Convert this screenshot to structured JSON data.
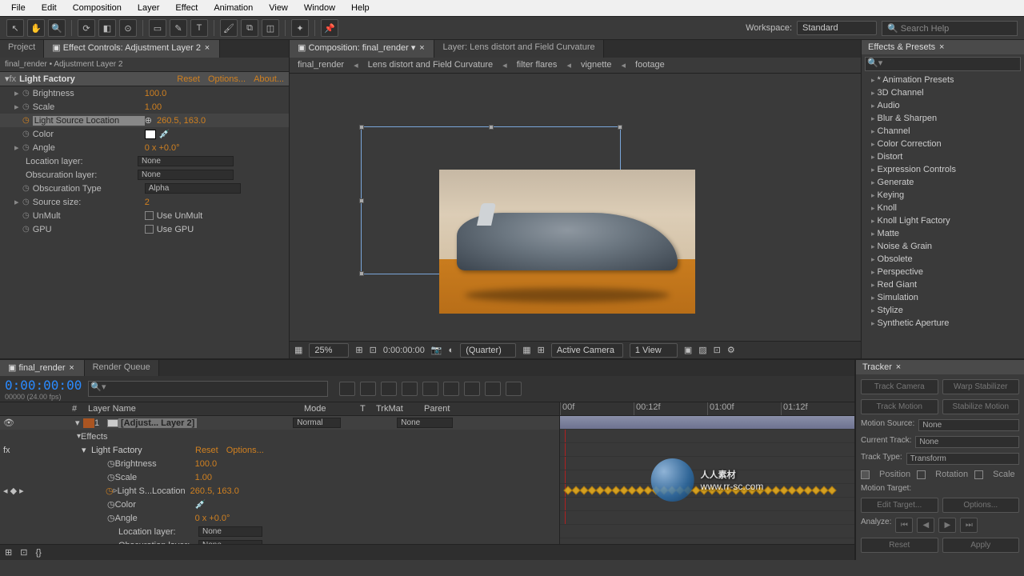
{
  "menu": [
    "File",
    "Edit",
    "Composition",
    "Layer",
    "Effect",
    "Animation",
    "View",
    "Window",
    "Help"
  ],
  "toolbar": {
    "workspace_label": "Workspace:",
    "workspace_value": "Standard",
    "search_placeholder": "Search Help"
  },
  "left": {
    "tab_project": "Project",
    "tab_effect_controls": "Effect Controls: Adjustment Layer 2",
    "breadcrumb": "final_render • Adjustment Layer 2",
    "effect_name": "Light Factory",
    "reset": "Reset",
    "options": "Options...",
    "about": "About...",
    "props": {
      "brightness": "Brightness",
      "brightness_val": "100.0",
      "scale": "Scale",
      "scale_val": "1.00",
      "lsl": "Light Source Location",
      "lsl_val": "260.5, 163.0",
      "color": "Color",
      "angle": "Angle",
      "angle_val": "0 x +0.0°",
      "loc_layer": "Location layer:",
      "obs_layer": "Obscuration layer:",
      "obs_type": "Obscuration Type",
      "obs_type_val": "Alpha",
      "src_size": "Source size:",
      "src_size_val": "2",
      "unmult": "UnMult",
      "use_unmult": "Use UnMult",
      "gpu": "GPU",
      "use_gpu": "Use GPU",
      "none": "None"
    }
  },
  "center": {
    "tab_comp": "Composition: final_render",
    "tab_layer": "Layer: Lens distort and Field Curvature",
    "crumb": [
      "final_render",
      "Lens distort and Field Curvature",
      "filter flares",
      "vignette",
      "footage"
    ],
    "footer": {
      "zoom": "25%",
      "time": "0:00:00:00",
      "quality": "(Quarter)",
      "camera": "Active Camera",
      "view": "1 View"
    }
  },
  "right": {
    "title": "Effects & Presets",
    "items": [
      "* Animation Presets",
      "3D Channel",
      "Audio",
      "Blur & Sharpen",
      "Channel",
      "Color Correction",
      "Distort",
      "Expression Controls",
      "Generate",
      "Keying",
      "Knoll",
      "Knoll Light Factory",
      "Matte",
      "Noise & Grain",
      "Obsolete",
      "Perspective",
      "Red Giant",
      "Simulation",
      "Stylize",
      "Synthetic Aperture"
    ]
  },
  "timeline": {
    "tab_comp": "final_render",
    "tab_rq": "Render Queue",
    "timecode": "0:00:00:00",
    "fps": "00000 (24.00 fps)",
    "col_num": "#",
    "col_layer": "Layer Name",
    "col_mode": "Mode",
    "col_trkmat": "TrkMat",
    "col_parent": "Parent",
    "col_t": "T",
    "ruler": [
      "00f",
      "00:12f",
      "01:00f",
      "01:12f"
    ],
    "layer_num": "1",
    "layer_name": "[Adjust... Layer 2]",
    "layer_mode": "Normal",
    "layer_parent": "None",
    "fx_effects": "Effects",
    "fx_name": "Light Factory",
    "fx_reset": "Reset",
    "fx_options": "Options...",
    "p_brightness": "Brightness",
    "p_brightness_val": "100.0",
    "p_scale": "Scale",
    "p_scale_val": "1.00",
    "p_lsl": "Light S...Location",
    "p_lsl_val": "260.5, 163.0",
    "p_color": "Color",
    "p_angle": "Angle",
    "p_angle_val": "0 x +0.0°",
    "p_loc": "Location layer:",
    "p_obs": "Obscuration layer:",
    "none": "None"
  },
  "tracker": {
    "title": "Tracker",
    "track_camera": "Track Camera",
    "warp": "Warp Stabilizer",
    "track_motion": "Track Motion",
    "stabilize": "Stabilize Motion",
    "motion_source": "Motion Source:",
    "motion_source_val": "None",
    "current_track": "Current Track:",
    "current_track_val": "None",
    "track_type": "Track Type:",
    "track_type_val": "Transform",
    "position": "Position",
    "rotation": "Rotation",
    "scale": "Scale",
    "motion_target": "Motion Target:",
    "edit_target": "Edit Target...",
    "options": "Options...",
    "analyze": "Analyze:",
    "reset": "Reset",
    "apply": "Apply"
  },
  "watermark": {
    "text": "人人素材",
    "url": "www.rr-sc.com"
  }
}
